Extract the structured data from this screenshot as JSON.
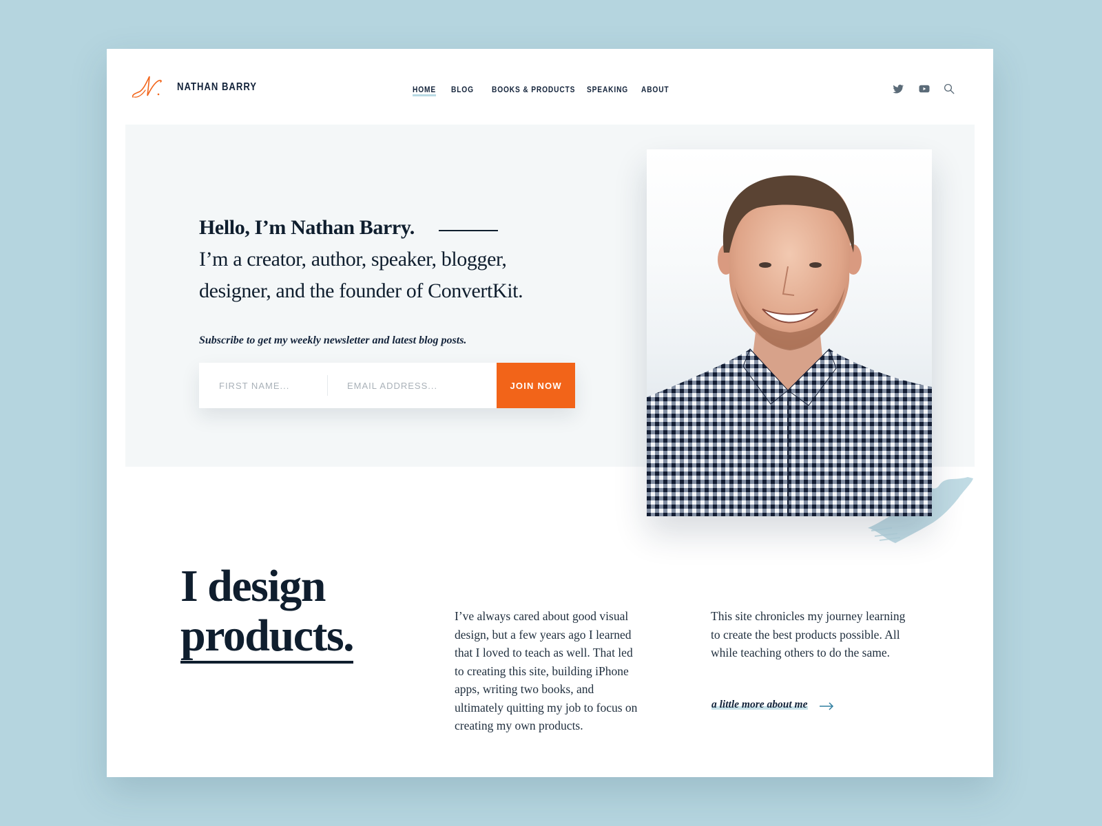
{
  "colors": {
    "background": "#b5d5df",
    "accent": "#f26419",
    "text": "#0f1e2e",
    "highlight": "#c9e3ea"
  },
  "header": {
    "logo_icon": "script-n-monogram-icon",
    "brand": "NATHAN BARRY",
    "nav": [
      {
        "label": "HOME",
        "active": true
      },
      {
        "label": "BLOG",
        "active": false
      },
      {
        "label": "BOOKS & PRODUCTS",
        "active": false
      },
      {
        "label": "SPEAKING",
        "active": false
      },
      {
        "label": "ABOUT",
        "active": false
      }
    ],
    "icons": [
      "twitter-icon",
      "youtube-icon",
      "search-icon"
    ]
  },
  "hero": {
    "title": "Hello, I’m Nathan Barry.",
    "subtitle": "I’m a creator, author, speaker, blogger, designer, and the founder of ConvertKit.",
    "subscribe_label": "Subscribe to get my weekly newsletter and latest blog posts.",
    "form": {
      "first_name_placeholder": "FIRST NAME...",
      "first_name_value": "",
      "email_placeholder": "EMAIL ADDRESS...",
      "email_value": "",
      "submit_label": "JOIN NOW"
    },
    "photo_alt": "Portrait of Nathan Barry smiling in a checkered shirt"
  },
  "about": {
    "title_line1": "I design",
    "title_line2": "products.",
    "paragraph1": "I’ve always cared about good visual design, but a few years ago I learned that I loved to teach as well. That led to creating this site, building iPhone apps, writing two books, and ultimately quitting my job to focus on creating my own products.",
    "paragraph2": "This site chronicles my journey learning to create the best products possible. All while teaching others to do the same.",
    "more_link": "a little more about me",
    "more_icon": "arrow-right-icon"
  }
}
